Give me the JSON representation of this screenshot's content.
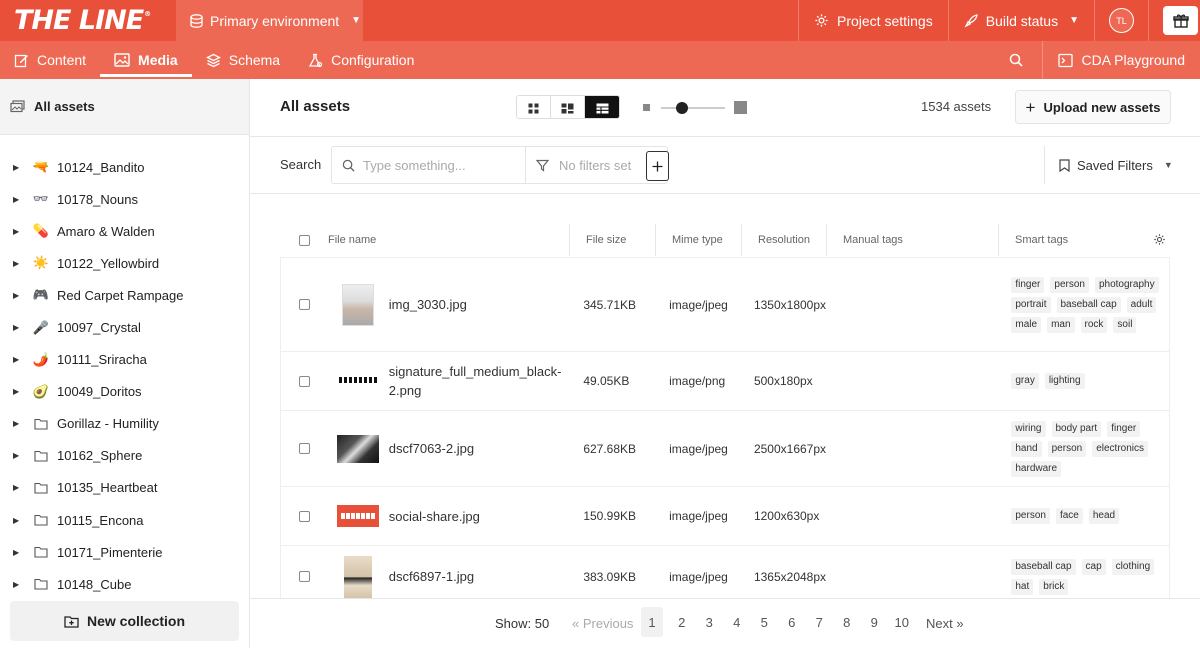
{
  "brand": {
    "logo_text": "THE LINE",
    "logo_mark": "®"
  },
  "environment": {
    "label": "Primary environment"
  },
  "top_actions": {
    "project_settings": "Project settings",
    "build_status": "Build status",
    "avatar_initials": "TL"
  },
  "nav": {
    "tabs": [
      {
        "label": "Content"
      },
      {
        "label": "Media"
      },
      {
        "label": "Schema"
      },
      {
        "label": "Configuration"
      }
    ],
    "cda_label": "CDA Playground"
  },
  "sidebar": {
    "all_assets": "All assets",
    "collections": [
      {
        "icon": "🔫",
        "label": "10124_Bandito"
      },
      {
        "icon": "👓",
        "label": "10178_Nouns"
      },
      {
        "icon": "💊",
        "label": "Amaro & Walden"
      },
      {
        "icon": "☀️",
        "label": "10122_Yellowbird"
      },
      {
        "icon": "🎮",
        "label": "Red Carpet Rampage"
      },
      {
        "icon": "🎤",
        "label": "10097_Crystal"
      },
      {
        "icon": "🌶️",
        "label": "10111_Sriracha"
      },
      {
        "icon": "🥑",
        "label": "10049_Doritos"
      },
      {
        "icon": "folder",
        "label": "Gorillaz - Humility"
      },
      {
        "icon": "folder",
        "label": "10162_Sphere"
      },
      {
        "icon": "folder",
        "label": "10135_Heartbeat"
      },
      {
        "icon": "folder",
        "label": "10115_Encona"
      },
      {
        "icon": "folder",
        "label": "10171_Pimenterie"
      },
      {
        "icon": "folder",
        "label": "10148_Cube"
      }
    ],
    "new_collection": "New collection"
  },
  "main": {
    "title": "All assets",
    "asset_count": "1534 assets",
    "upload_label": "Upload new assets",
    "search_label": "Search",
    "search_placeholder": "Type something...",
    "filters_text": "No filters set",
    "saved_filters": "Saved Filters"
  },
  "table": {
    "headers": {
      "file_name": "File name",
      "file_size": "File size",
      "mime_type": "Mime type",
      "resolution": "Resolution",
      "manual_tags": "Manual tags",
      "smart_tags": "Smart tags"
    },
    "rows": [
      {
        "name": "img_3030.jpg",
        "size": "345.71KB",
        "mime": "image/jpeg",
        "res": "1350x1800px",
        "tags": [
          "finger",
          "person",
          "photography",
          "portrait",
          "baseball cap",
          "adult",
          "male",
          "man",
          "rock",
          "soil"
        ]
      },
      {
        "name": "signature_full_medium_black-2.png",
        "size": "49.05KB",
        "mime": "image/png",
        "res": "500x180px",
        "tags": [
          "gray",
          "lighting"
        ]
      },
      {
        "name": "dscf7063-2.jpg",
        "size": "627.68KB",
        "mime": "image/jpeg",
        "res": "2500x1667px",
        "tags": [
          "wiring",
          "body part",
          "finger",
          "hand",
          "person",
          "electronics",
          "hardware"
        ]
      },
      {
        "name": "social-share.jpg",
        "size": "150.99KB",
        "mime": "image/jpeg",
        "res": "1200x630px",
        "tags": [
          "person",
          "face",
          "head"
        ]
      },
      {
        "name": "dscf6897-1.jpg",
        "size": "383.09KB",
        "mime": "image/jpeg",
        "res": "1365x2048px",
        "tags": [
          "baseball cap",
          "cap",
          "clothing",
          "hat",
          "brick"
        ]
      }
    ]
  },
  "pagination": {
    "show": "Show: 50",
    "previous": "« Previous",
    "pages": [
      "1",
      "2",
      "3",
      "4",
      "5",
      "6",
      "7",
      "8",
      "9",
      "10"
    ],
    "current": "1",
    "next": "Next »"
  }
}
